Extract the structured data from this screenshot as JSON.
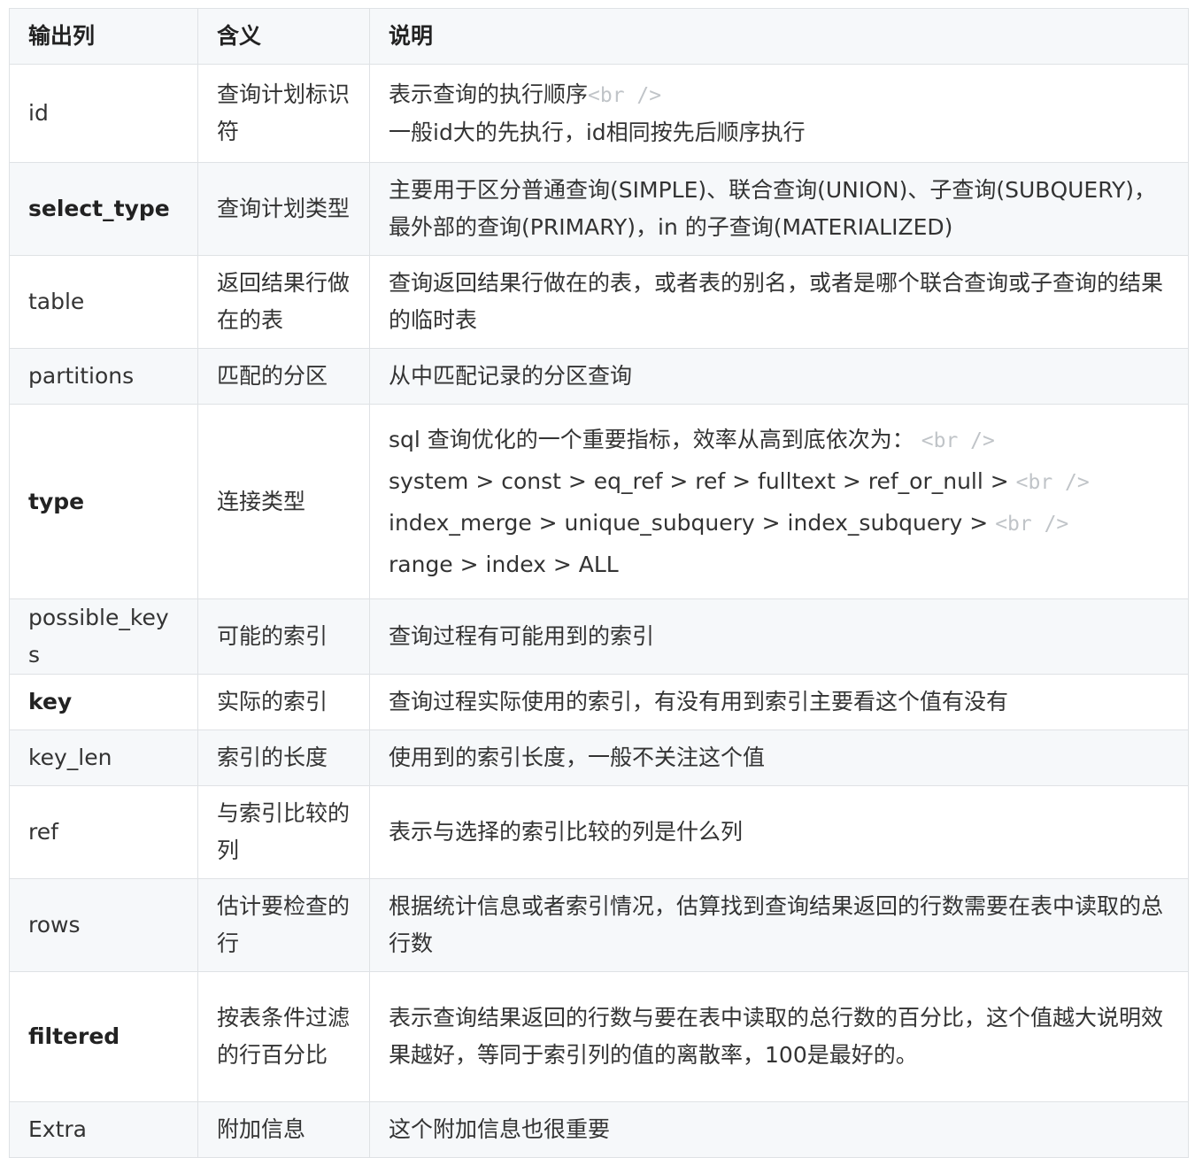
{
  "table": {
    "headers": [
      "输出列",
      "含义",
      "说明"
    ],
    "rows": [
      {
        "column": "id",
        "meaning": "查询计划标识符",
        "desc": "表示查询的执行顺序",
        "br": "<br />",
        "desc2": "一般id大的先执行，id相同按先后顺序执行",
        "bold": false
      },
      {
        "column": "select_type",
        "meaning": "查询计划类型",
        "desc": "主要用于区分普通查询(SIMPLE)、联合查询(UNION)、子查询(SUBQUERY)，最外部的查询(PRIMARY)，in 的子查询(MATERIALIZED)",
        "bold": true
      },
      {
        "column": "table",
        "meaning": "返回结果行做在的表",
        "desc": "查询返回结果行做在的表，或者表的别名，或者是哪个联合查询或子查询的结果的临时表",
        "bold": false
      },
      {
        "column": "partitions",
        "meaning": "匹配的分区",
        "desc": "从中匹配记录的分区查询",
        "bold": false
      },
      {
        "column": "type",
        "meaning": "连接类型",
        "lines": [
          "sql 查询优化的一个重要指标，效率从高到底依次为：",
          "system > const > eq_ref > ref > fulltext > ref_or_null >",
          "index_merge > unique_subquery > index_subquery >",
          "range > index > ALL"
        ],
        "br": "<br />",
        "bold": true
      },
      {
        "column": "possible_keys",
        "meaning": "可能的索引",
        "desc": "查询过程有可能用到的索引",
        "bold": false
      },
      {
        "column": "key",
        "meaning": "实际的索引",
        "desc": "查询过程实际使用的索引，有没有用到索引主要看这个值有没有",
        "bold": true
      },
      {
        "column": "key_len",
        "meaning": "索引的长度",
        "desc": "使用到的索引长度，一般不关注这个值",
        "bold": false
      },
      {
        "column": "ref",
        "meaning": "与索引比较的列",
        "desc": "表示与选择的索引比较的列是什么列",
        "bold": false
      },
      {
        "column": "rows",
        "meaning": "估计要检查的行",
        "desc": "根据统计信息或者索引情况，估算找到查询结果返回的行数需要在表中读取的总行数",
        "bold": false
      },
      {
        "column": "filtered",
        "meaning": "按表条件过滤的行百分比",
        "desc": "表示查询结果返回的行数与要在表中读取的总行数的百分比，这个值越大说明效果越好，等同于索引列的值的离散率，100是最好的。",
        "bold": true
      },
      {
        "column": "Extra",
        "meaning": "附加信息",
        "desc": "这个附加信息也很重要",
        "bold": false
      }
    ]
  }
}
